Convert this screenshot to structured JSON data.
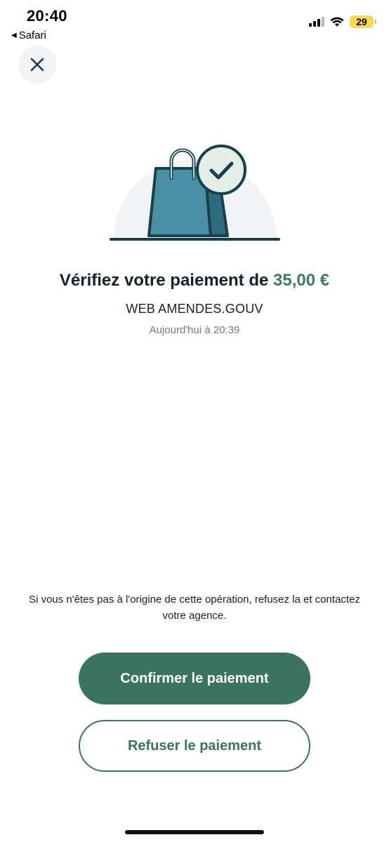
{
  "status_bar": {
    "time": "20:40",
    "back_app": "Safari",
    "battery_level": "29",
    "battery_color": "#f7d85a"
  },
  "close_button": {
    "icon": "close-icon"
  },
  "illustration": {
    "icon": "shopping-bag-check-icon",
    "bag_color": "#4a90a4",
    "outline_color": "#17404d",
    "check_bg": "#e3efe6"
  },
  "payment": {
    "title_prefix": "Vérifiez votre paiement de",
    "amount": "35,00 €",
    "merchant": "WEB AMENDES.GOUV",
    "date": "Aujourd'hui à 20:39"
  },
  "notice": "Si vous n'êtes pas à l'origine de cette opération, refusez la et contactez votre agence.",
  "actions": {
    "confirm_label": "Confirmer le paiement",
    "refuse_label": "Refuser le paiement"
  },
  "colors": {
    "accent": "#3a7460",
    "amount": "#3f7a68",
    "text": "#15212b",
    "muted": "#6f7b84"
  }
}
